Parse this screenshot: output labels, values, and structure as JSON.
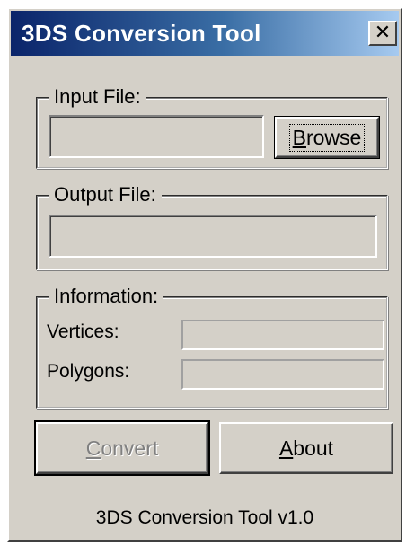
{
  "window": {
    "title": "3DS Conversion Tool",
    "close_symbol": "✕"
  },
  "input_group": {
    "label": "Input File:",
    "field_value": "",
    "browse_label": "Browse"
  },
  "output_group": {
    "label": "Output File:",
    "field_value": ""
  },
  "info_group": {
    "label": "Information:",
    "vertices_label": "Vertices:",
    "vertices_value": "",
    "polygons_label": "Polygons:",
    "polygons_value": ""
  },
  "buttons": {
    "convert_label": "Convert",
    "about_label": "About"
  },
  "footer": {
    "version_text": "3DS Conversion Tool v1.0"
  },
  "colors": {
    "title_start": "#0a246a",
    "title_end": "#a6caf0",
    "face": "#d4d0c8"
  },
  "icons": {
    "close": "close-icon"
  }
}
